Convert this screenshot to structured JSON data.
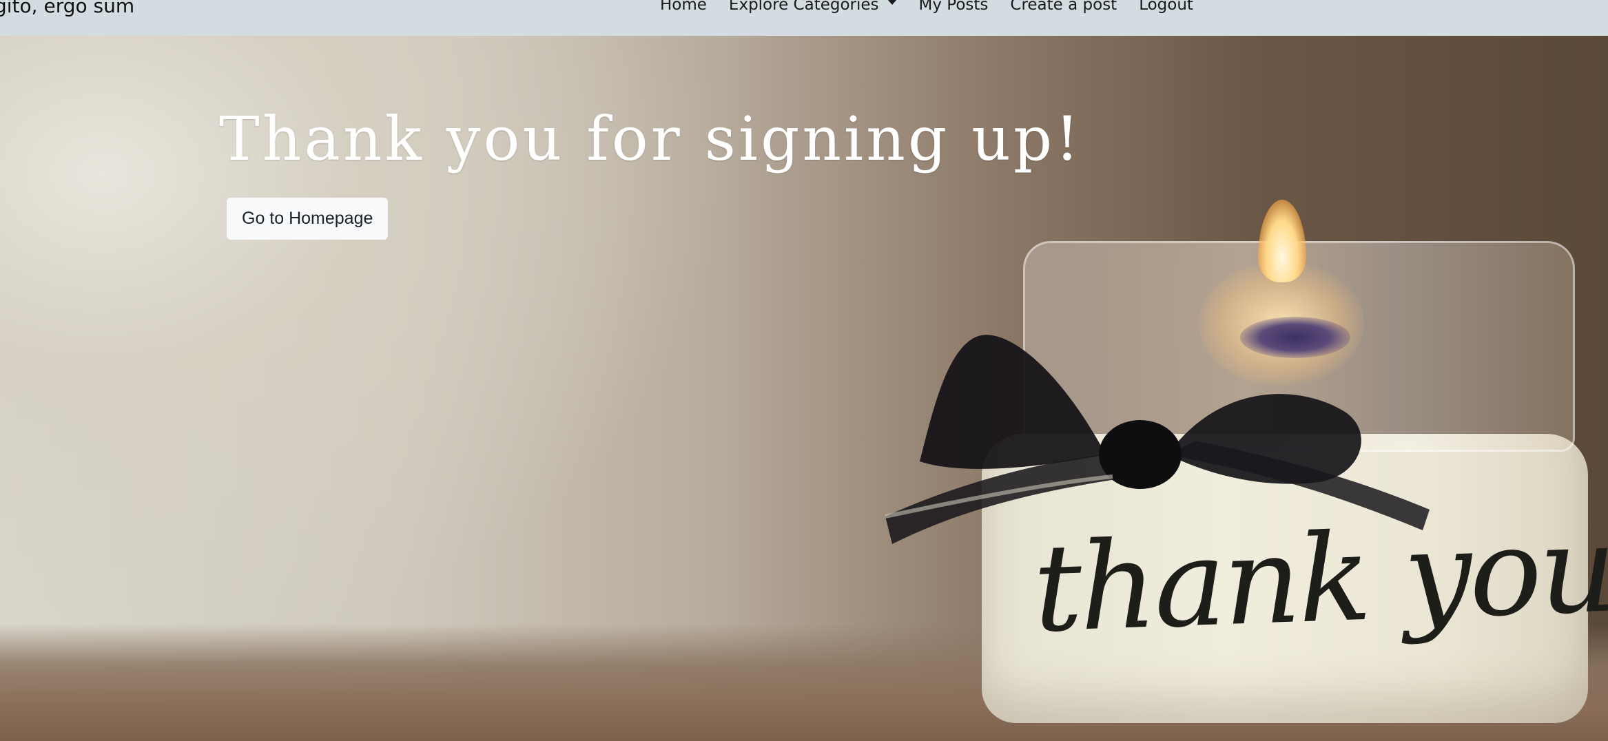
{
  "navbar": {
    "brand": "gito, ergo sum",
    "links": [
      {
        "label": "Home"
      },
      {
        "label": "Explore Categories",
        "dropdown": true
      },
      {
        "label": "My Posts"
      },
      {
        "label": "Create a post"
      },
      {
        "label": "Logout"
      }
    ]
  },
  "hero": {
    "headline": "Thank you for signing up!",
    "button_label": "Go to Homepage",
    "background_image": "candle-jar-with-bow-photo",
    "candle_text": "thank you"
  },
  "colors": {
    "navbar_bg": "#d3dce0",
    "headline": "#ffffff",
    "button_bg": "#f8f9fa"
  }
}
